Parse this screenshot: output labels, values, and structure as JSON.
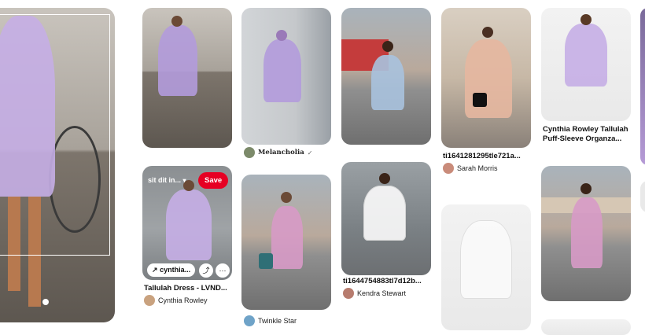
{
  "pins": {
    "col2_top": {},
    "col2_hover": {
      "board_label": "sit dit in...",
      "save_label": "Save",
      "link_label": "cynthia...",
      "share_icon": "share-icon",
      "more_icon": "more-icon",
      "title": "Tallulah Dress - LVND...",
      "author": "Cynthia Rowley"
    },
    "col3_top": {
      "author": "Melancholia"
    },
    "col3_bottom": {
      "author": "Twinkle Star"
    },
    "col4_top": {},
    "col4_bottom": {
      "title": "ti1644754883tl7d12b...",
      "author": "Kendra Stewart"
    },
    "col5_top": {
      "title": "ti1641281295tle721a...",
      "author": "Sarah Morris"
    },
    "col5_bottom": {},
    "col6_top": {
      "title_line1": "Cynthia Rowley Tallulah",
      "title_line2": "Puff-Sleeve Organza..."
    },
    "col6_bottom": {}
  },
  "colors": {
    "save_button": "#e60023",
    "dress_lavender": "#b39bdc"
  }
}
